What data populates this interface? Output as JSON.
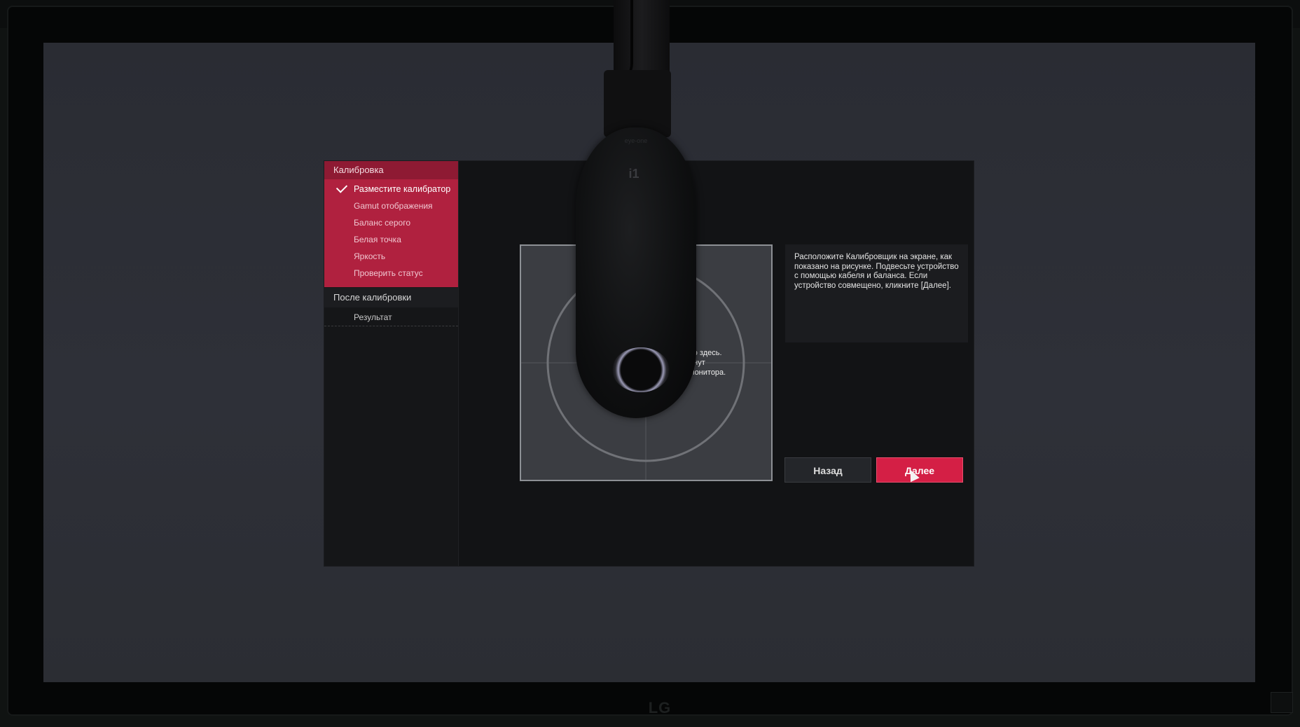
{
  "sidebar": {
    "calibration_header": "Калибровка",
    "steps": [
      {
        "label": "Разместите калибратор",
        "done": true
      },
      {
        "label": "Gamut отображения",
        "done": false
      },
      {
        "label": "Баланс серого",
        "done": false
      },
      {
        "label": "Белая точка",
        "done": false
      },
      {
        "label": "Яркость",
        "done": false
      },
      {
        "label": "Проверить статус",
        "done": false
      }
    ],
    "after_header": "После калибровки",
    "after_items": [
      "Результат"
    ]
  },
  "diagram": {
    "note": "во здесь.\nинут\nмонитора."
  },
  "info": {
    "text": "Расположите Калибровщик на экране, как показано на рисунке. Подвесьте устройство с помощью кабеля и баланса. Если устройство совмещено, кликните [Далее]."
  },
  "buttons": {
    "back": "Назад",
    "next": "Далее"
  },
  "monitor": {
    "brand": "LG"
  },
  "device": {
    "logo": "eye-one",
    "badge": "i1"
  },
  "colors": {
    "accent": "#d41f45",
    "sidebar_active": "#b0213f",
    "screen_bg": "#2e3038",
    "app_bg": "#121315"
  },
  "icons": [
    "check-icon",
    "cursor-icon",
    "cable-icon"
  ]
}
